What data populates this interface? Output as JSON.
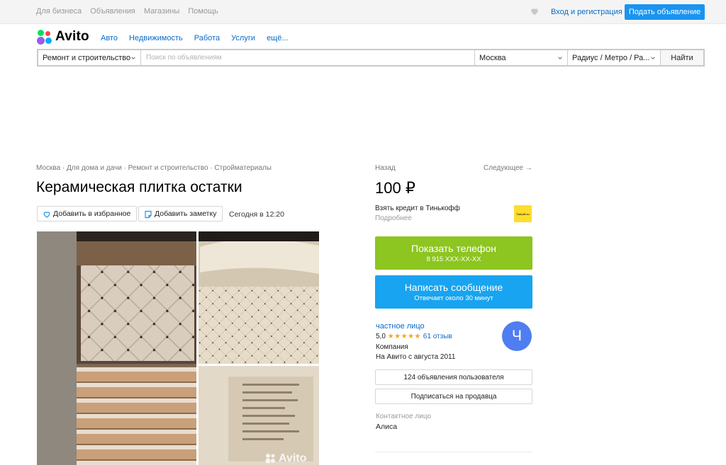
{
  "topbar": {
    "links": [
      "Для бизнеса",
      "Объявления",
      "Магазины",
      "Помощь"
    ],
    "login": "Вход и регистрация",
    "post_button": "Подать объявление"
  },
  "logo": {
    "text": "Avito"
  },
  "nav": [
    "Авто",
    "Недвижимость",
    "Работа",
    "Услуги",
    "ещё..."
  ],
  "search": {
    "category": "Ремонт и строительство",
    "placeholder": "Поиск по объявлениям",
    "city": "Москва",
    "radius": "Радиус / Метро / Ра...",
    "find_button": "Найти"
  },
  "breadcrumbs": [
    "Москва",
    "Для дома и дачи",
    "Ремонт и строительство",
    "Стройматериалы"
  ],
  "breadcrumb_separator": " · ",
  "listing": {
    "title": "Керамическая плитка остатки",
    "favorite_button": "Добавить в избранное",
    "note_button": "Добавить заметку",
    "date": "Сегодня в 12:20",
    "watermark": "Avito"
  },
  "sidebar": {
    "back": "Назад",
    "next": "Следующее →",
    "price": "100 ₽",
    "credit": "Взять кредит в Тинькофф",
    "credit_more": "Подробнее",
    "tinkoff_logo": "Tinkoff.ru",
    "phone_button": "Показать телефон",
    "phone_number": "8 915 XXX-XX-XX",
    "message_button": "Написать сообщение",
    "message_sub": "Отвечает около 30 минут",
    "seller_type": "частное лицо",
    "rating_value": "5,0",
    "rating_stars": "★★★★★",
    "reviews": "61 отзыв",
    "seller_kind": "Компания",
    "since": "На Авито с августа 2011",
    "ads_button": "124 объявления пользователя",
    "subscribe_button": "Подписаться на продавца",
    "contact_label": "Контактное лицо",
    "contact_name": "Алиса",
    "avatar_letter": "Ч"
  },
  "colors": {
    "accent_blue": "#1a94f0",
    "link_blue": "#0a6bc9",
    "phone_green": "#8dc521",
    "message_blue": "#18a4f0",
    "avatar_blue": "#4f7ef2",
    "star_orange": "#f5a623"
  }
}
